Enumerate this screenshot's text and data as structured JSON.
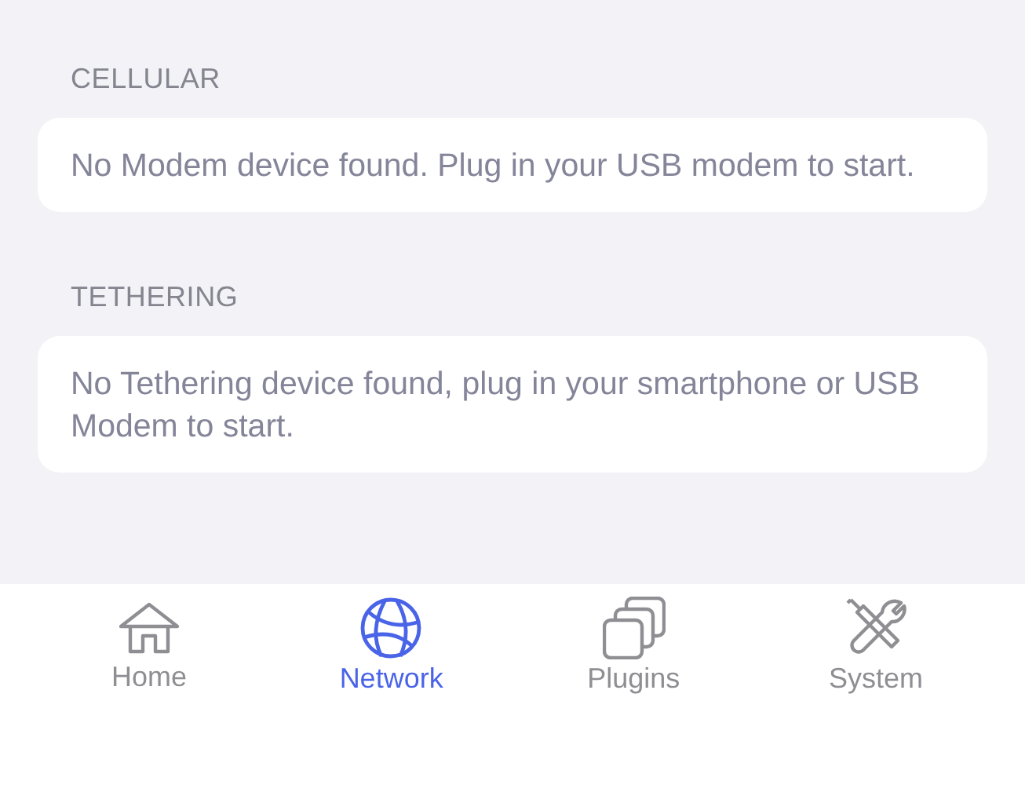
{
  "sections": [
    {
      "header": "CELLULAR",
      "message": "No Modem device found. Plug in your USB modem to start."
    },
    {
      "header": "TETHERING",
      "message": "No Tethering device found, plug in your smartphone or USB Modem to start."
    }
  ],
  "tab_bar": [
    {
      "kind": "home",
      "label": "Home",
      "selected": false
    },
    {
      "kind": "network",
      "label": "Network",
      "selected": true
    },
    {
      "kind": "plugins",
      "label": "Plugins",
      "selected": false
    },
    {
      "kind": "system",
      "label": "System",
      "selected": false
    }
  ]
}
